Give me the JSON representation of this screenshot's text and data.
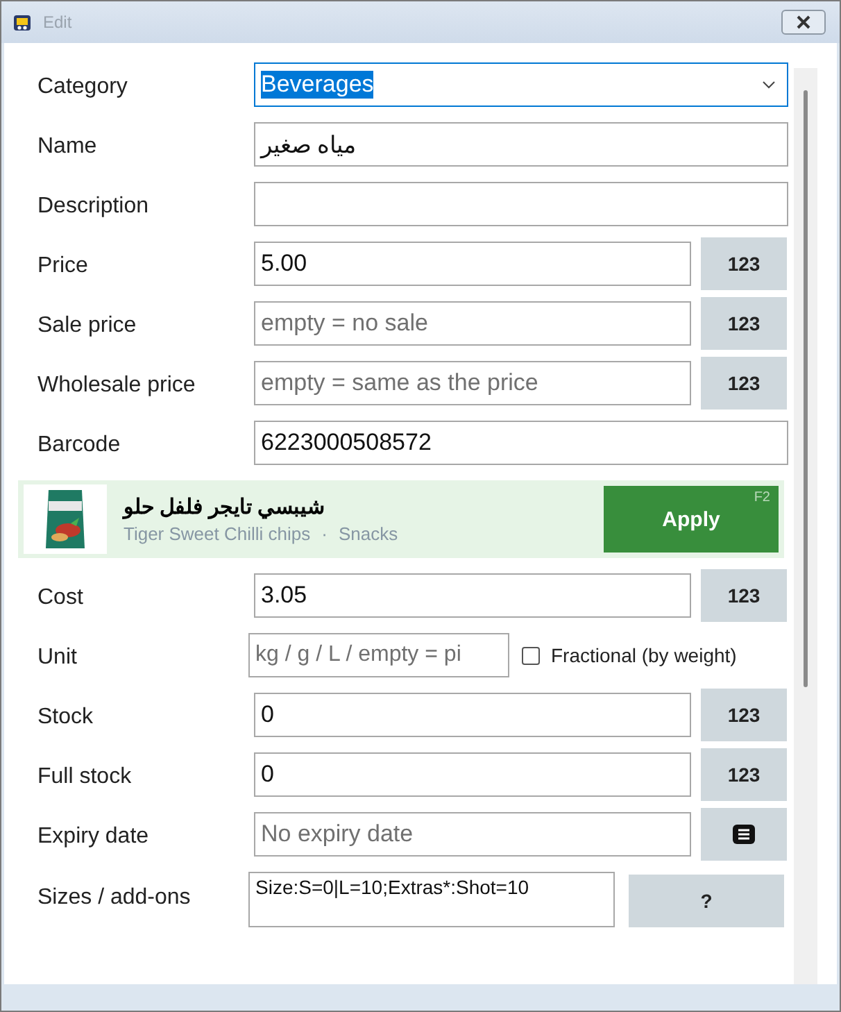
{
  "window": {
    "title": "Edit"
  },
  "rows": [
    {
      "kind": "select",
      "label": "Category",
      "value": "Beverages",
      "selected_text": true
    },
    {
      "kind": "text",
      "label": "Name",
      "value": "مياه صغير"
    },
    {
      "kind": "text",
      "label": "Description"
    },
    {
      "kind": "keypad",
      "label": "Price",
      "value": "5.00",
      "button": "123"
    },
    {
      "kind": "keypad",
      "label": "Sale price",
      "placeholder": "empty = no sale",
      "button": "123"
    },
    {
      "kind": "keypad",
      "label": "Wholesale price",
      "placeholder": "empty = same as the price",
      "button": "123"
    },
    {
      "kind": "text",
      "label": "Barcode",
      "value": "6223000508572"
    },
    {
      "kind": "suggestion",
      "title": "شيبسي تايجر فلفل حلو",
      "name": "Tiger Sweet Chilli chips",
      "separator": "·",
      "category": "Snacks",
      "button": "Apply",
      "shortcut": "F2"
    },
    {
      "kind": "keypad",
      "label": "Cost",
      "value": "3.05",
      "button": "123"
    },
    {
      "kind": "unit",
      "label": "Unit",
      "placeholder": "kg / g / L / empty = pi",
      "checkbox": "Fractional (by weight)",
      "checked": false
    },
    {
      "kind": "keypad",
      "label": "Stock",
      "value": "0",
      "button": "123"
    },
    {
      "kind": "keypad",
      "label": "Full stock",
      "value": "0",
      "button": "123"
    },
    {
      "kind": "calendar",
      "label": "Expiry date",
      "placeholder": "No expiry date"
    },
    {
      "kind": "help",
      "label": "Sizes / add-ons",
      "value": "Size:S=0|L=10;Extras*:Shot=10",
      "button": "?"
    }
  ]
}
